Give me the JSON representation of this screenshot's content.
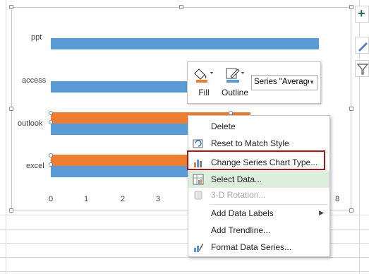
{
  "chart_data": {
    "type": "bar",
    "orientation": "horizontal",
    "categories": [
      "ppt",
      "access",
      "outlook",
      "excel"
    ],
    "series": [
      {
        "values": [
          7.5,
          4.2,
          7.3,
          7.3
        ],
        "color": "#5b9bd5"
      },
      {
        "values": [
          0,
          0,
          5.6,
          5.1
        ],
        "color": "#ed7d31"
      }
    ],
    "x_ticks": [
      "0",
      "1",
      "2",
      "3",
      "4",
      "5",
      "6",
      "7",
      "8"
    ],
    "xlim": [
      0,
      8
    ],
    "grid": false,
    "legend": "none"
  },
  "side_buttons": {
    "elements_icon": "plus-icon",
    "styles_icon": "brush-icon",
    "filter_icon": "filter-icon"
  },
  "mini_toolbar": {
    "fill_label": "Fill",
    "outline_label": "Outline",
    "series_select_value": "Series \"Average Score\"",
    "fill_color": "#ed7d31",
    "outline_color": "#5b9bd5"
  },
  "context_menu": {
    "items": [
      {
        "label": "Delete",
        "icon": "none",
        "disabled": false
      },
      {
        "label": "Reset to Match Style",
        "icon": "reset-style-icon",
        "disabled": false
      },
      {
        "label": "Change Series Chart Type...",
        "icon": "chart-type-icon",
        "disabled": false
      },
      {
        "label": "Select Data...",
        "icon": "select-data-icon",
        "disabled": false
      },
      {
        "label": "3-D Rotation...",
        "icon": "rotation-icon",
        "disabled": true
      },
      {
        "label": "Add Data Labels",
        "icon": "none",
        "disabled": false,
        "submenu_indicator": "▶"
      },
      {
        "label": "Add Trendline...",
        "icon": "none",
        "disabled": false
      },
      {
        "label": "Format Data Series...",
        "icon": "format-series-icon",
        "disabled": false
      }
    ]
  },
  "colors": {
    "accent_highlight": "#a31a1a",
    "hover": "#ddeedd"
  }
}
